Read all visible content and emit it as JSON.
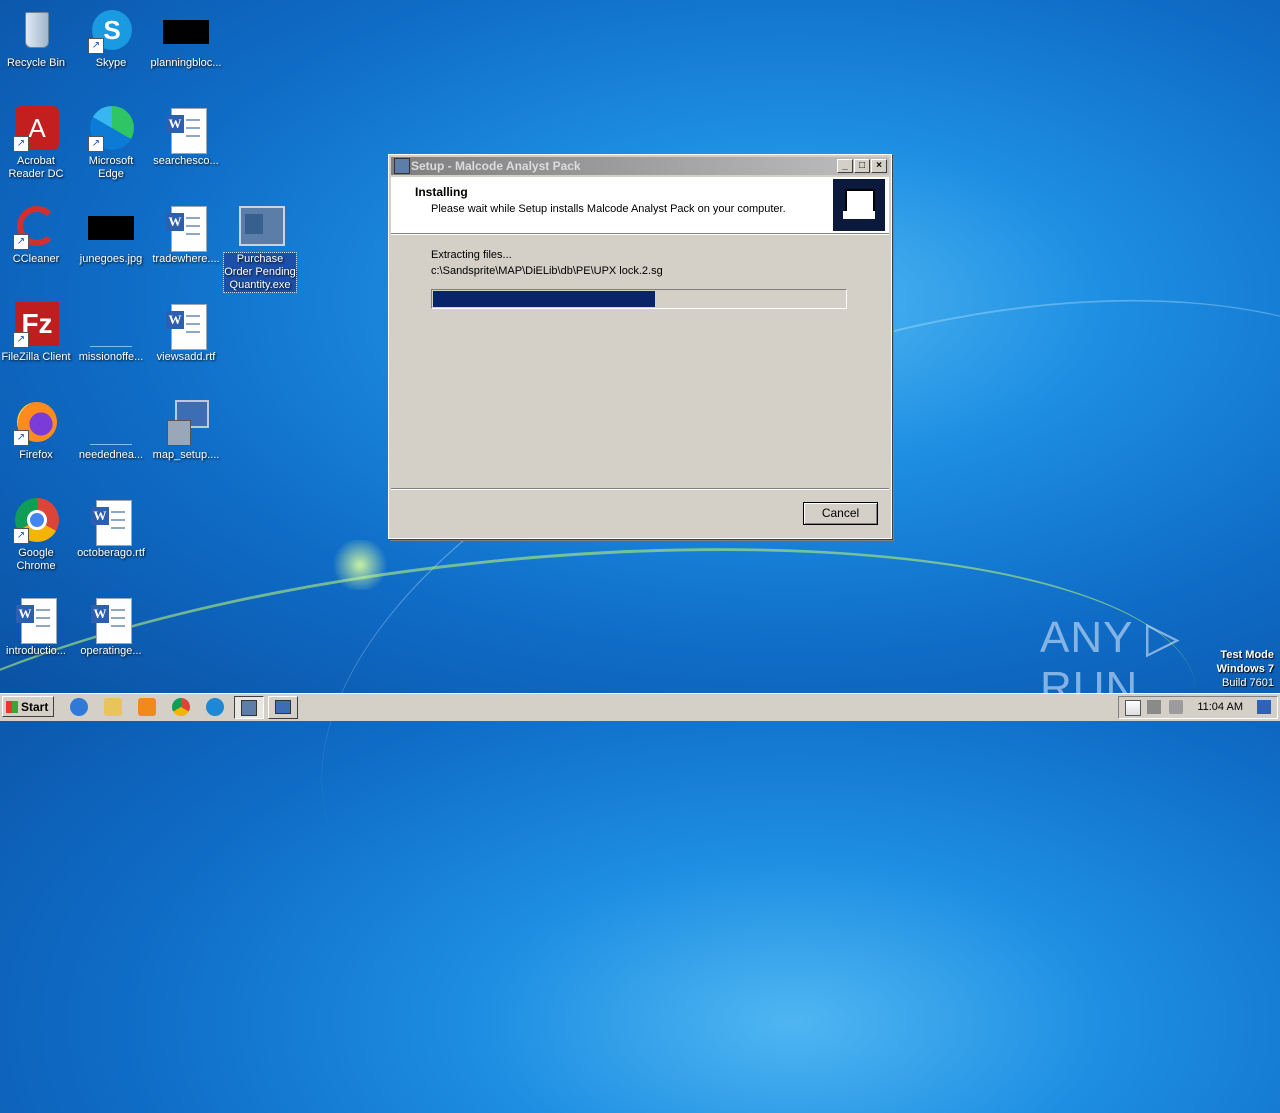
{
  "desktop": {
    "icons": [
      {
        "label": "Recycle Bin"
      },
      {
        "label": "Skype"
      },
      {
        "label": "planningbloc..."
      },
      {
        "label": "Acrobat Reader DC"
      },
      {
        "label": "Microsoft Edge"
      },
      {
        "label": "searchesco..."
      },
      {
        "label": "CCleaner"
      },
      {
        "label": "junegoes.jpg"
      },
      {
        "label": "tradewhere...."
      },
      {
        "label": "Purchase Order Pending Quantity.exe"
      },
      {
        "label": "FileZilla Client"
      },
      {
        "label": "missionoffe..."
      },
      {
        "label": "viewsadd.rtf"
      },
      {
        "label": "Firefox"
      },
      {
        "label": "neededneа..."
      },
      {
        "label": "map_setup...."
      },
      {
        "label": "Google Chrome"
      },
      {
        "label": "octoberago.rtf"
      },
      {
        "label": "introductio..."
      },
      {
        "label": "operatinge..."
      }
    ]
  },
  "setup_window": {
    "title": "Setup - Malcode Analyst Pack",
    "header_title": "Installing",
    "header_subtitle": "Please wait while Setup installs Malcode Analyst Pack on your computer.",
    "status_line1": "Extracting files...",
    "status_line2": "c:\\Sandsprite\\MAP\\DiELib\\db\\PE\\UPX lock.2.sg",
    "progress_fraction": 0.54,
    "cancel_label": "Cancel",
    "minimize": "_",
    "maximize": "□",
    "close": "×"
  },
  "watermark": {
    "brand": "ANY ▷ RUN",
    "line1": "Test Mode",
    "line2": "Windows 7",
    "line3": "Build 7601"
  },
  "taskbar": {
    "start_label": "Start",
    "clock": "11:04 AM"
  },
  "colors": {
    "progress_fill": "#0a246a",
    "selection": "#1c4fa8"
  }
}
